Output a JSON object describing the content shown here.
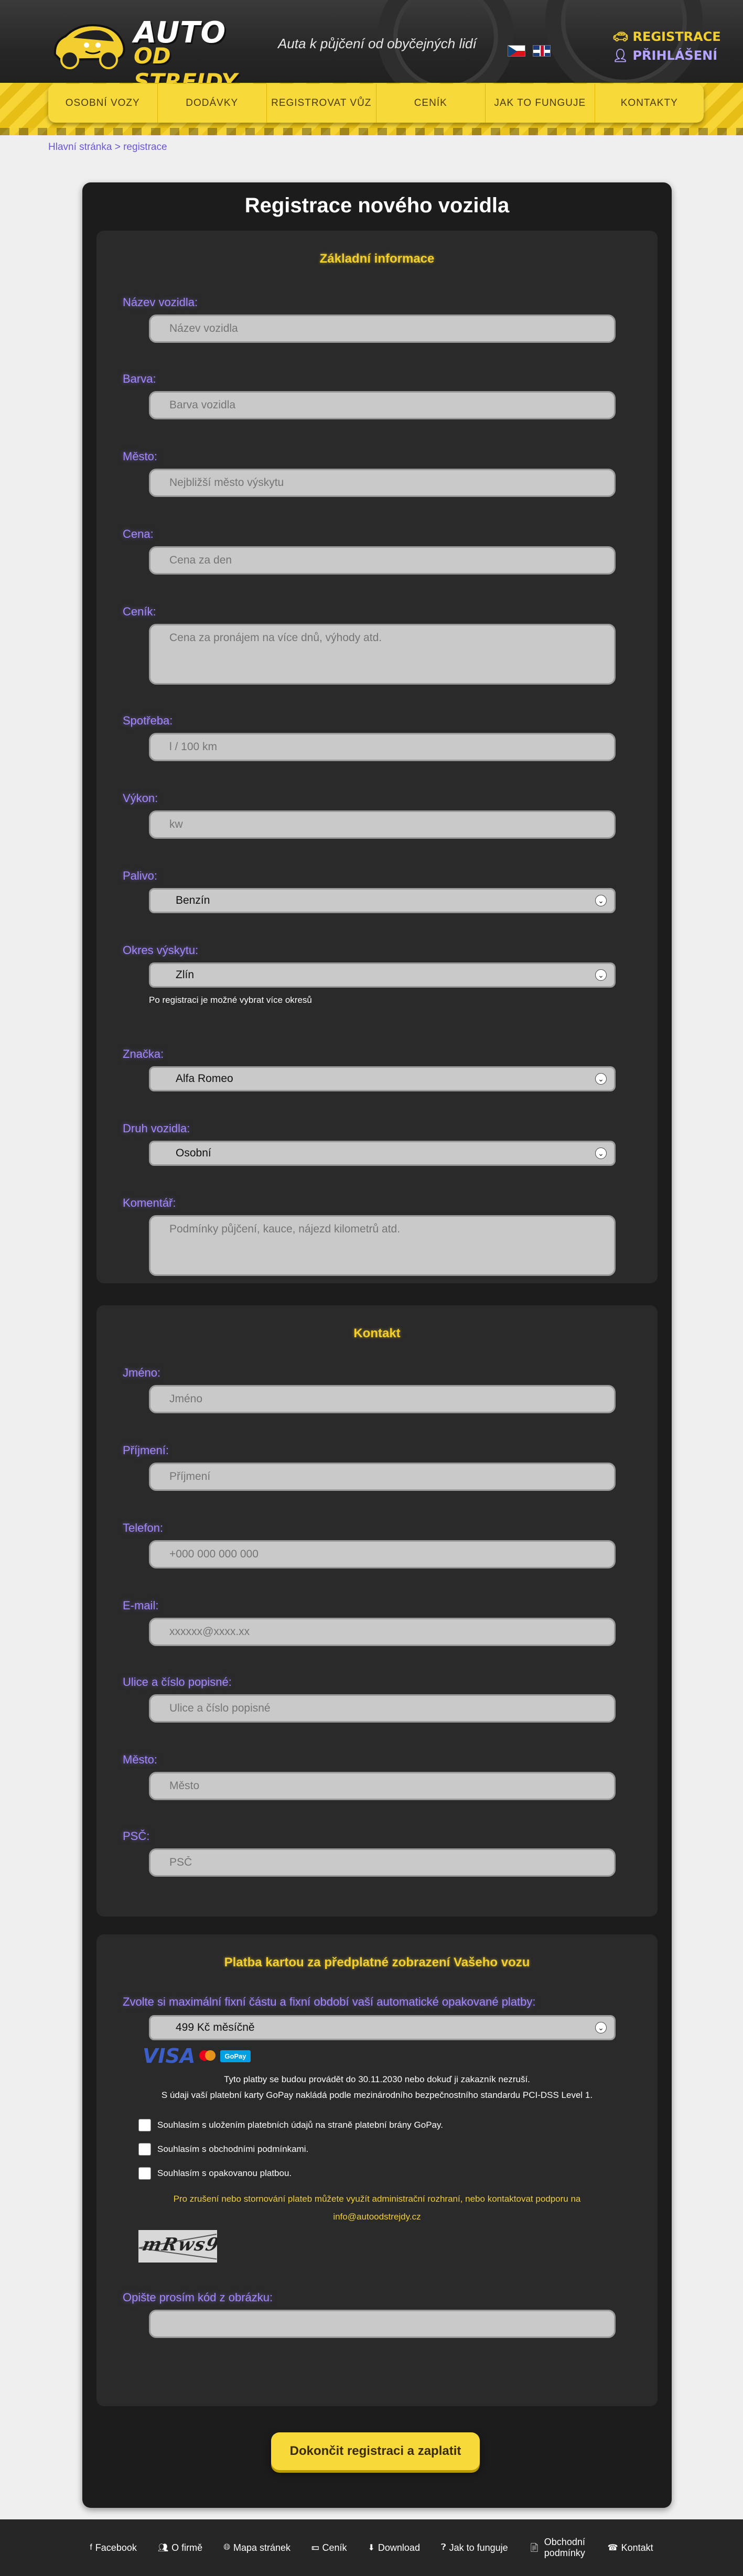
{
  "header": {
    "logo_line1": "AUTO",
    "logo_line2": "OD STREJDY",
    "tagline": "Auta k půjčení od obyčejných lidí",
    "register": "REGISTRACE",
    "login": "PŘIHLÁŠENÍ"
  },
  "nav": [
    "OSOBNÍ VOZY",
    "DODÁVKY",
    "REGISTROVAT VŮZ",
    "CENÍK",
    "JAK TO FUNGUJE",
    "KONTAKTY"
  ],
  "breadcrumb": {
    "home": "Hlavní stránka",
    "sep": " > ",
    "current": "registrace"
  },
  "page_title": "Registrace nového vozidla",
  "basic": {
    "title": "Základní informace",
    "name": {
      "label": "Název vozidla:",
      "placeholder": "Název vozidla"
    },
    "color": {
      "label": "Barva:",
      "placeholder": "Barva vozidla"
    },
    "city": {
      "label": "Město:",
      "placeholder": "Nejbližší město výskytu"
    },
    "price": {
      "label": "Cena:",
      "placeholder": "Cena za den"
    },
    "pricelist": {
      "label": "Ceník:",
      "placeholder": "Cena za pronájem na více dnů, výhody atd."
    },
    "consumption": {
      "label": "Spotřeba:",
      "placeholder": "l / 100 km"
    },
    "power": {
      "label": "Výkon:",
      "placeholder": "kw"
    },
    "fuel": {
      "label": "Palivo:",
      "value": "Benzín"
    },
    "district": {
      "label": "Okres výskytu:",
      "value": "Zlín",
      "hint": "Po registraci je možné vybrat více okresů"
    },
    "brand": {
      "label": "Značka:",
      "value": "Alfa Romeo"
    },
    "type": {
      "label": "Druh vozidla:",
      "value": "Osobní"
    },
    "comment": {
      "label": "Komentář:",
      "placeholder": "Podmínky půjčení, kauce, nájezd kilometrů atd."
    }
  },
  "contact": {
    "title": "Kontakt",
    "firstname": {
      "label": "Jméno:",
      "placeholder": "Jméno"
    },
    "surname": {
      "label": "Příjmení:",
      "placeholder": "Příjmení"
    },
    "phone": {
      "label": "Telefon:",
      "placeholder": "+000 000 000 000"
    },
    "email": {
      "label": "E-mail:",
      "placeholder": "xxxxxx@xxxx.xx"
    },
    "street": {
      "label": "Ulice a číslo popisné:",
      "placeholder": "Ulice a číslo popisné"
    },
    "city": {
      "label": "Město:",
      "placeholder": "Město"
    },
    "zip": {
      "label": "PSČ:",
      "placeholder": "PSČ"
    }
  },
  "payment": {
    "title": "Platba kartou za předplatné zobrazení Vašeho vozu",
    "plan_label": "Zvolte si maximální fixní částu a fixní období vaší automatické opakované platby:",
    "plan_value": "499 Kč měsíčně",
    "visa": "VISA",
    "gopay": "GoPay",
    "info1": "Tyto platby se budou provádět do 30.11.2030 nebo dokuď ji zakazník nezruší.",
    "info2": "S údaji vaší platební karty GoPay nakládá podle mezinárodního bezpečnostního standardu PCI-DSS Level 1.",
    "check1": "Souhlasím s uložením platebních údajů na straně platební brány GoPay.",
    "check2": "Souhlasím s obchodními podmínkami.",
    "check3": "Souhlasím s opakovanou platbou.",
    "note1": "Pro zrušení nebo stornování plateb můžete využít administrační rozhraní, nebo kontaktovat podporu na",
    "note2": "info@autoodstrejdy.cz",
    "captcha_text": "mRws9",
    "captcha_label": "Opište prosím kód z obrázku:"
  },
  "submit": "Dokončit registraci a zaplatit",
  "footer": [
    {
      "icon": "facebook-icon",
      "label": "Facebook"
    },
    {
      "icon": "users-icon",
      "label": "O firmě"
    },
    {
      "icon": "globe-icon",
      "label": "Mapa stránek"
    },
    {
      "icon": "money-icon",
      "label": "Ceník"
    },
    {
      "icon": "download-icon",
      "label": "Download"
    },
    {
      "icon": "question-icon",
      "label": "Jak to funguje"
    },
    {
      "icon": "document-icon",
      "label": "Obchodní podmínky"
    },
    {
      "icon": "phone-icon",
      "label": "Kontakt"
    }
  ],
  "colors": {
    "accent": "#f2cf2f",
    "label": "#a487ff",
    "card": "#1c1c1c",
    "section": "#2a2a2a"
  }
}
